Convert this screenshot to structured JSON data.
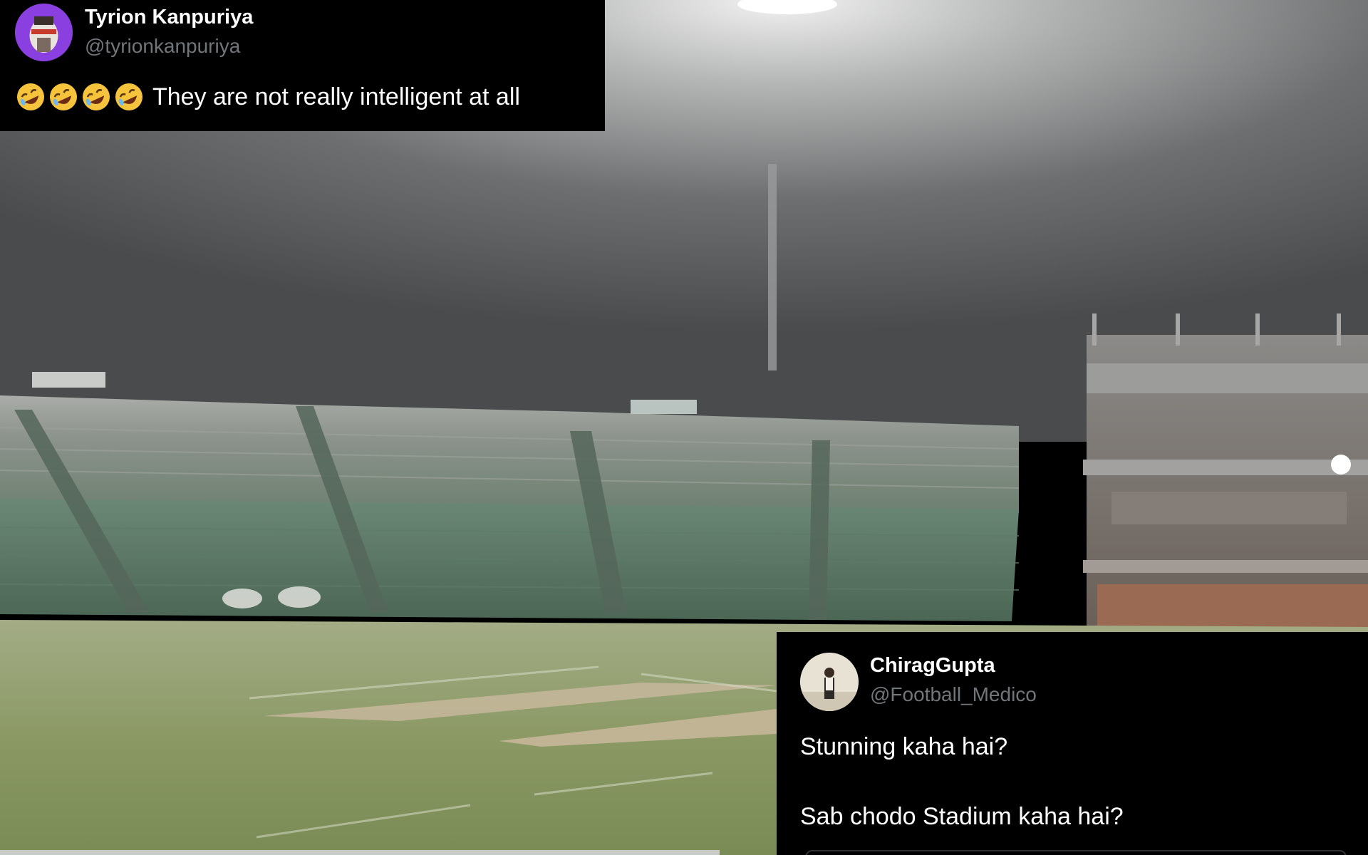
{
  "tweets": [
    {
      "display_name": "Tyrion Kanpuriya",
      "handle": "@tyrionkanpuriya",
      "emoji_count": 4,
      "emoji_icon": "rolling-on-floor-laughing-emoji",
      "text": "They are not really intelligent at all",
      "avatar_color": "#8a3fe0"
    },
    {
      "display_name": "ChiragGupta",
      "handle": "@Football_Medico",
      "text_lines": [
        "Stunning kaha hai?",
        "Sab chodo Stadium kaha hai?"
      ],
      "avatar_color": "#e8e2d4"
    }
  ],
  "colors": {
    "card_background": "#000000",
    "handle_gray": "#71767b",
    "pitch_green": "#7a8d55",
    "stand_green": "#4a6b55"
  }
}
